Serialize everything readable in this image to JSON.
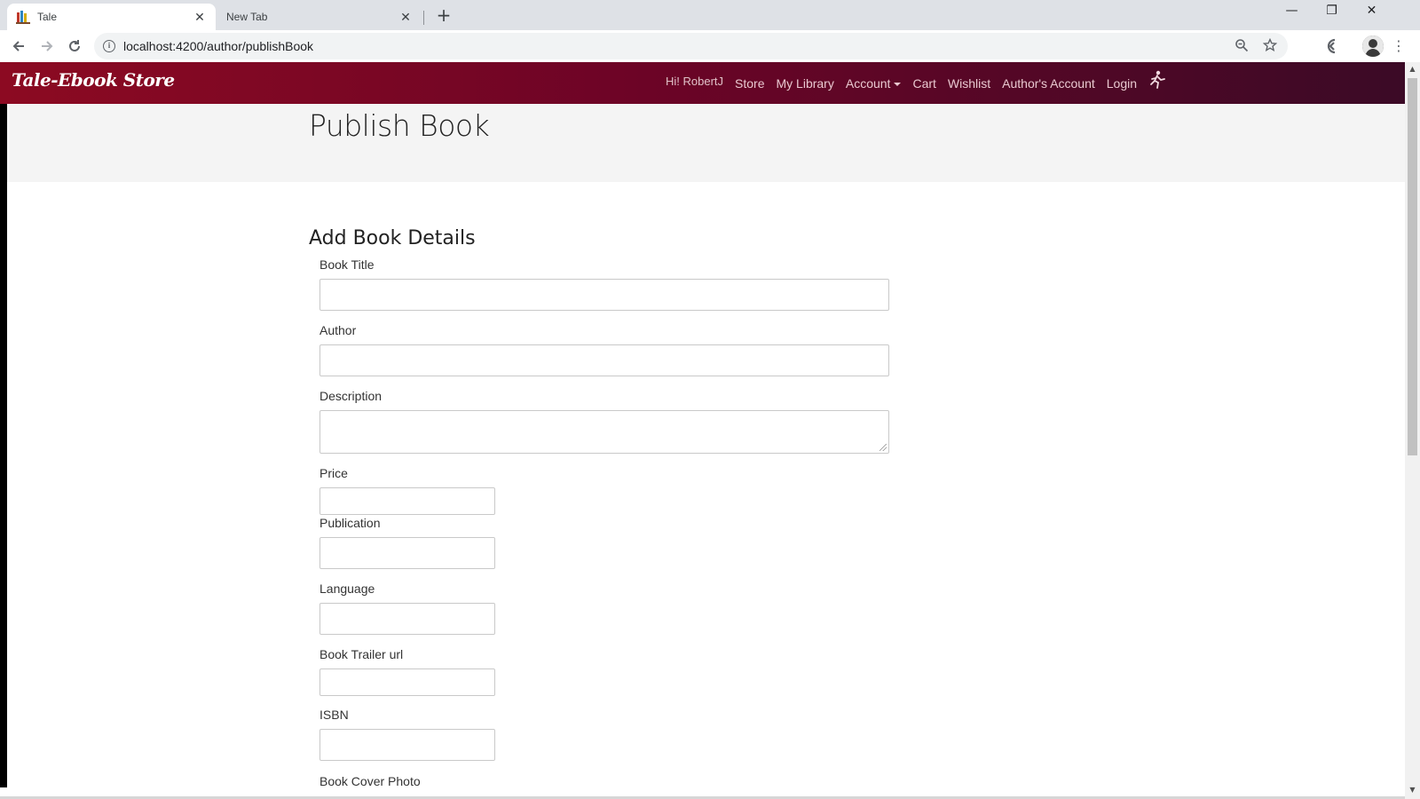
{
  "browser": {
    "tabs": [
      {
        "title": "Tale",
        "active": true
      },
      {
        "title": "New Tab",
        "active": false
      }
    ],
    "url": "localhost:4200/author/publishBook",
    "window_controls": {
      "minimize": "—",
      "restore": "❐",
      "close": "✕"
    }
  },
  "navbar": {
    "brand": "Tale-Ebook Store",
    "greeting": "Hi! RobertJ",
    "links": [
      "Store",
      "My Library",
      "Account",
      "Cart",
      "Wishlist",
      "Author's Account",
      "Login"
    ]
  },
  "page": {
    "title": "Publish Book",
    "form_heading": "Add Book Details",
    "fields": [
      {
        "label": "Book Title",
        "value": ""
      },
      {
        "label": "Author",
        "value": ""
      },
      {
        "label": "Description",
        "value": ""
      },
      {
        "label": "Price",
        "value": ""
      },
      {
        "label": "Publication",
        "value": ""
      },
      {
        "label": "Language",
        "value": ""
      },
      {
        "label": "Book Trailer url",
        "value": ""
      },
      {
        "label": "ISBN",
        "value": ""
      },
      {
        "label": "Book Cover Photo"
      }
    ]
  },
  "colors": {
    "navbar_start": "#8c0a22",
    "navbar_end": "#3b0a26",
    "jumbotron_bg": "#f4f4f4"
  }
}
